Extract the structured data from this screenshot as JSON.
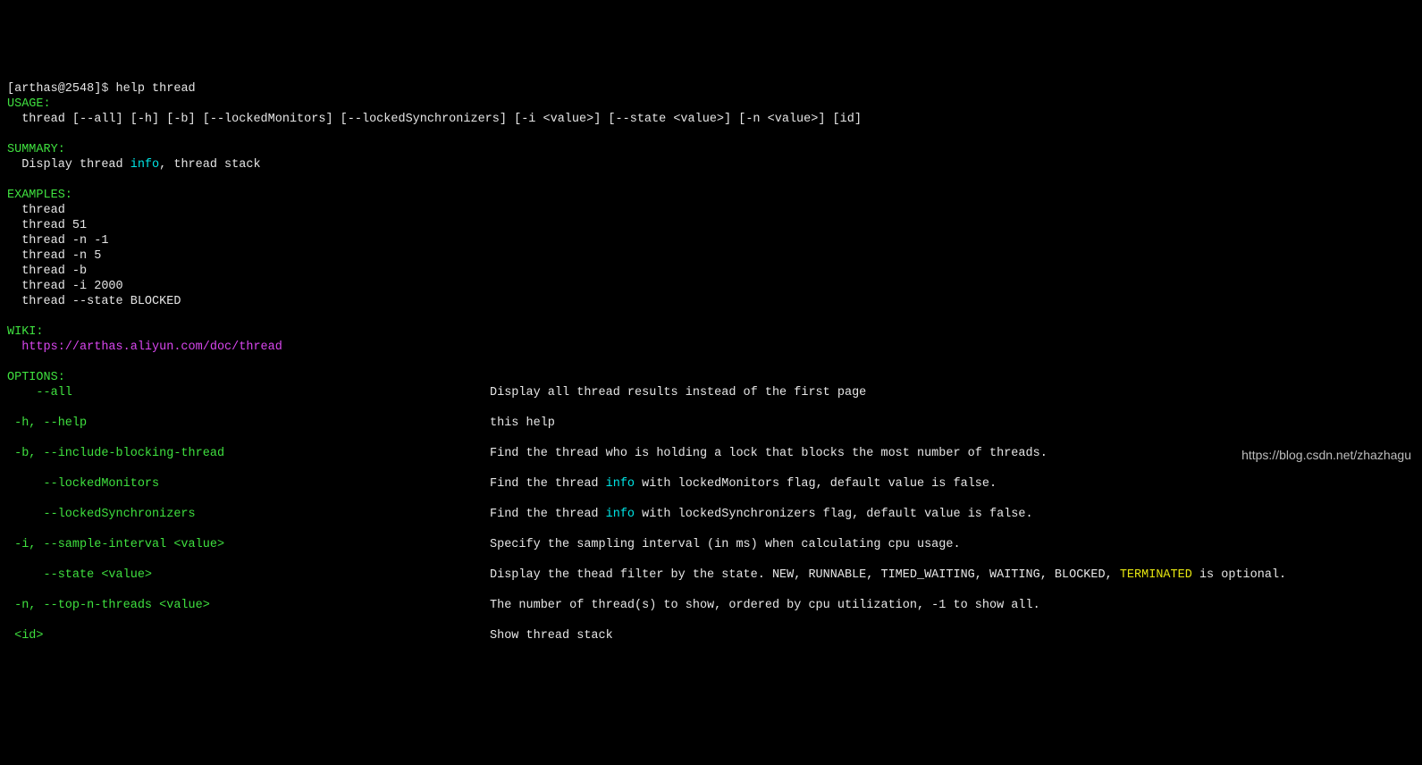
{
  "prompt": {
    "text": "[arthas@2548]",
    "dollar": "$ ",
    "command": "help thread"
  },
  "usage": {
    "header": "USAGE:",
    "body": "  thread [--all] [-h] [-b] [--lockedMonitors] [--lockedSynchronizers] [-i <value>] [--state <value>] [-n <value>] [id]"
  },
  "summary": {
    "header": "SUMMARY:",
    "prefix": "  Display thread ",
    "info": "info",
    "suffix": ", thread stack"
  },
  "examples": {
    "header": "EXAMPLES:",
    "lines": [
      "  thread",
      "  thread 51",
      "  thread -n -1",
      "  thread -n 5",
      "  thread -b",
      "  thread -i 2000",
      "  thread --state BLOCKED"
    ]
  },
  "wiki": {
    "header": "WIKI:",
    "url": "  https://arthas.aliyun.com/doc/thread"
  },
  "options": {
    "header": "OPTIONS:",
    "rows": [
      {
        "opt": "    --all",
        "desc": "Display all thread results instead of the first page"
      },
      {
        "opt": " -h, --help",
        "desc": "this help"
      },
      {
        "opt": " -b, --include-blocking-thread",
        "desc": "Find the thread who is holding a lock that blocks the most number of threads."
      },
      {
        "opt": "     --lockedMonitors",
        "pre": "Find the thread ",
        "info": "info",
        "post": " with lockedMonitors flag, default value is false."
      },
      {
        "opt": "     --lockedSynchronizers",
        "pre": "Find the thread ",
        "info": "info",
        "post": " with lockedSynchronizers flag, default value is false."
      },
      {
        "opt": " -i, --sample-interval <value>",
        "desc": "Specify the sampling interval (in ms) when calculating cpu usage."
      },
      {
        "opt": "     --state <value>",
        "state_a": "Display the thead filter by the state. NEW, RUNNABLE, TIMED_WAITING, WAITING, BLOCKED, ",
        "term": "TERMINATED",
        "state_b": " is optional."
      },
      {
        "opt": " -n, --top-n-threads <value>",
        "desc": "The number of thread(s) to show, ordered by cpu utilization, -1 to show all."
      },
      {
        "opt": " <id>",
        "desc": "Show thread stack"
      }
    ]
  },
  "watermark": "https://blog.csdn.net/zhazhagu"
}
